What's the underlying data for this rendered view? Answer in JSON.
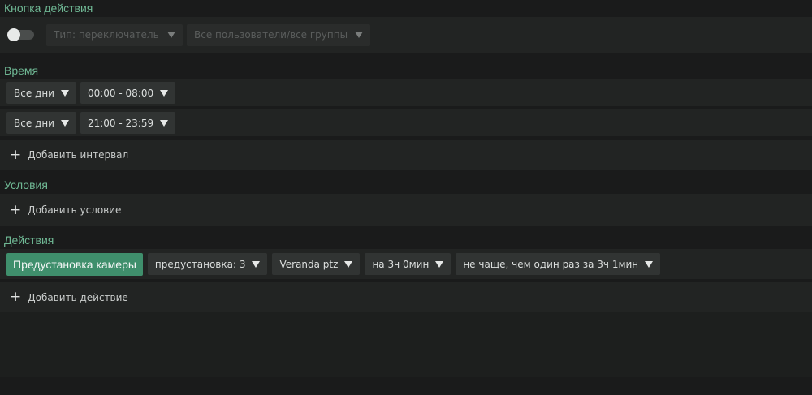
{
  "action_button_section": {
    "title": "Кнопка действия",
    "type_select": "Тип: переключатель",
    "users_select": "Все пользователи/все группы"
  },
  "time_section": {
    "title": "Время",
    "intervals": [
      {
        "days": "Все дни",
        "range": "00:00 - 08:00"
      },
      {
        "days": "Все дни",
        "range": "21:00 - 23:59"
      }
    ],
    "add_label": "Добавить интервал"
  },
  "conditions_section": {
    "title": "Условия",
    "add_label": "Добавить условие"
  },
  "actions_section": {
    "title": "Действия",
    "action": {
      "name": "Предустановка камеры",
      "preset": "предустановка: 3",
      "camera": "Veranda ptz",
      "duration": "на 3ч 0мин",
      "frequency": "не чаще, чем один раз за 3ч 1мин"
    },
    "add_label": "Добавить действие"
  },
  "colors": {
    "accent": "#6fb894",
    "action_button": "#3f8f6c",
    "background": "#1a1b1b",
    "row": "#222423"
  }
}
